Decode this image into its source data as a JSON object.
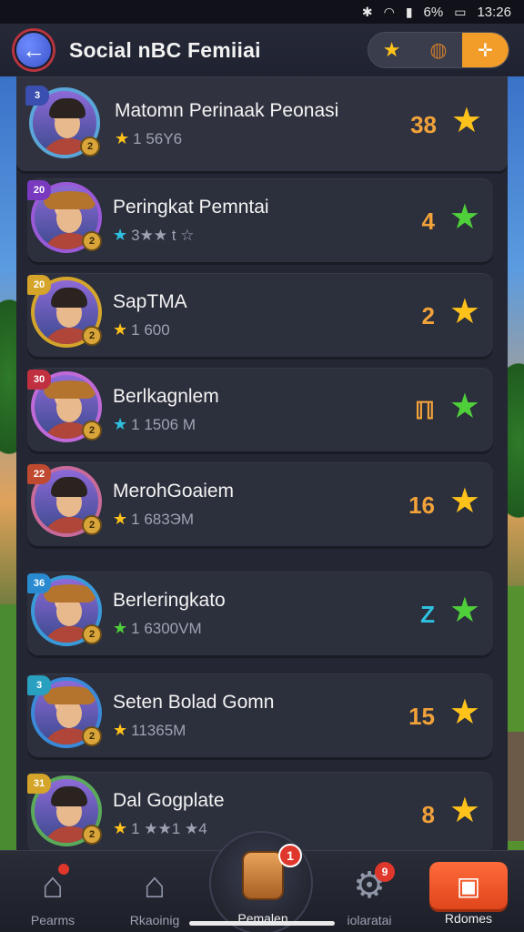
{
  "statusbar": {
    "time": "13:26",
    "battery": "6%"
  },
  "header": {
    "back_icon": "back-arrow-icon",
    "title": "Social nBC Femiiai"
  },
  "leaderboard": [
    {
      "name": "Matomn Perinaak Peonasi",
      "sub": "1 56Y6",
      "score": "38",
      "star_color": "#ffc21a",
      "sub_star_color": "#ffc21a",
      "tag_color": "#3a4fb0",
      "ring_color": "#5aa6d8",
      "rank_tag": "3"
    },
    {
      "name": "Peringkat Pemntai",
      "sub": "3★★ t ☆",
      "score": "4",
      "star_color": "#4fcf3a",
      "sub_star_color": "#2ec0e0",
      "tag_color": "#7a3ac0",
      "ring_color": "#9a5ad8",
      "rank_tag": "20"
    },
    {
      "name": "SapTMA",
      "sub": "1 600",
      "score": "2",
      "star_color": "#ffc21a",
      "sub_star_color": "#ffc21a",
      "tag_color": "#d4a52a",
      "ring_color": "#d4a52a",
      "rank_tag": "20"
    },
    {
      "name": "Berlkagnlem",
      "sub": "1 1506 M",
      "score": "ℿ",
      "star_color": "#4fcf3a",
      "sub_star_color": "#2ec0e0",
      "tag_color": "#c03040",
      "ring_color": "#c06ad8",
      "rank_tag": "30"
    },
    {
      "name": "MerohGoaiem",
      "sub": "1 683ЭM",
      "score": "16",
      "star_color": "#ffc21a",
      "sub_star_color": "#ffc21a",
      "tag_color": "#c04a30",
      "ring_color": "#c86a9a",
      "rank_tag": "22"
    },
    {
      "name": "Berleringkato",
      "sub": "1 6300VM",
      "score": "Z",
      "score_color": "#2ec0e0",
      "star_color": "#4fcf3a",
      "sub_star_color": "#4fcf3a",
      "tag_color": "#2a8ad0",
      "ring_color": "#3a9ad8",
      "rank_tag": "36"
    },
    {
      "name": "Seten Bolad Gomn",
      "sub": "11365M",
      "score": "15",
      "star_color": "#ffc21a",
      "sub_star_color": "#ffc21a",
      "tag_color": "#2aa0c0",
      "ring_color": "#3a8ad8",
      "rank_tag": "3"
    },
    {
      "name": "Dal Gogplate",
      "sub": "1 ★★1 ★4",
      "score": "8",
      "star_color": "#ffc21a",
      "sub_star_color": "#ffc21a",
      "tag_color": "#d4a52a",
      "ring_color": "#5aaa5a",
      "rank_tag": "31"
    }
  ],
  "bottomnav": {
    "items": [
      {
        "label": "Pearms",
        "icon": "home-icon"
      },
      {
        "label": "Rkaoinig",
        "icon": "house-icon"
      },
      {
        "label": "Pemalen",
        "icon": "treasure-icon",
        "badge": "1"
      },
      {
        "label": "iolaratai",
        "icon": "gear-icon",
        "badge": "9"
      },
      {
        "label": "Rdomes",
        "icon": "shop-icon"
      }
    ]
  }
}
